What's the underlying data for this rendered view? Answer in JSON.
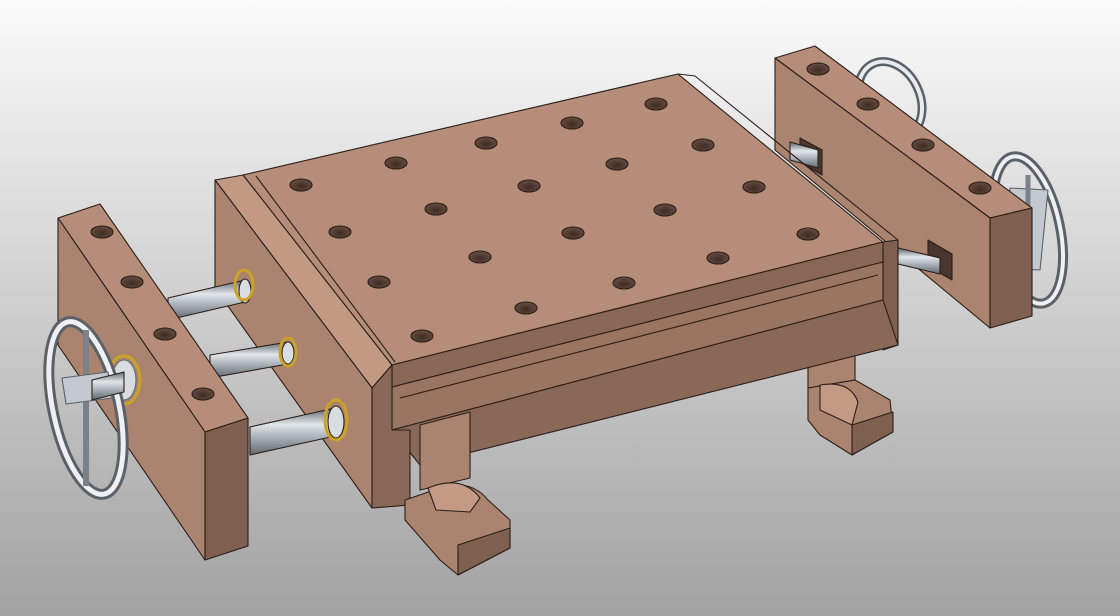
{
  "colors": {
    "background_top": "#fafafa",
    "background_bottom": "#a2a2a2",
    "wood_top": "#b58d79",
    "wood_light": "#ab8470",
    "wood_side": "#7f5f50",
    "wood_dark": "#6d5144",
    "hole_inner": "#4a362c",
    "steel_light": "#e2e6ea",
    "steel_mid": "#9aa2aa",
    "steel_dark": "#5f666e",
    "brass": "#c9a227",
    "edge": "#2a1e18"
  },
  "icons": {
    "handwheel": "handwheel-icon",
    "rod": "guide-rod-icon"
  }
}
